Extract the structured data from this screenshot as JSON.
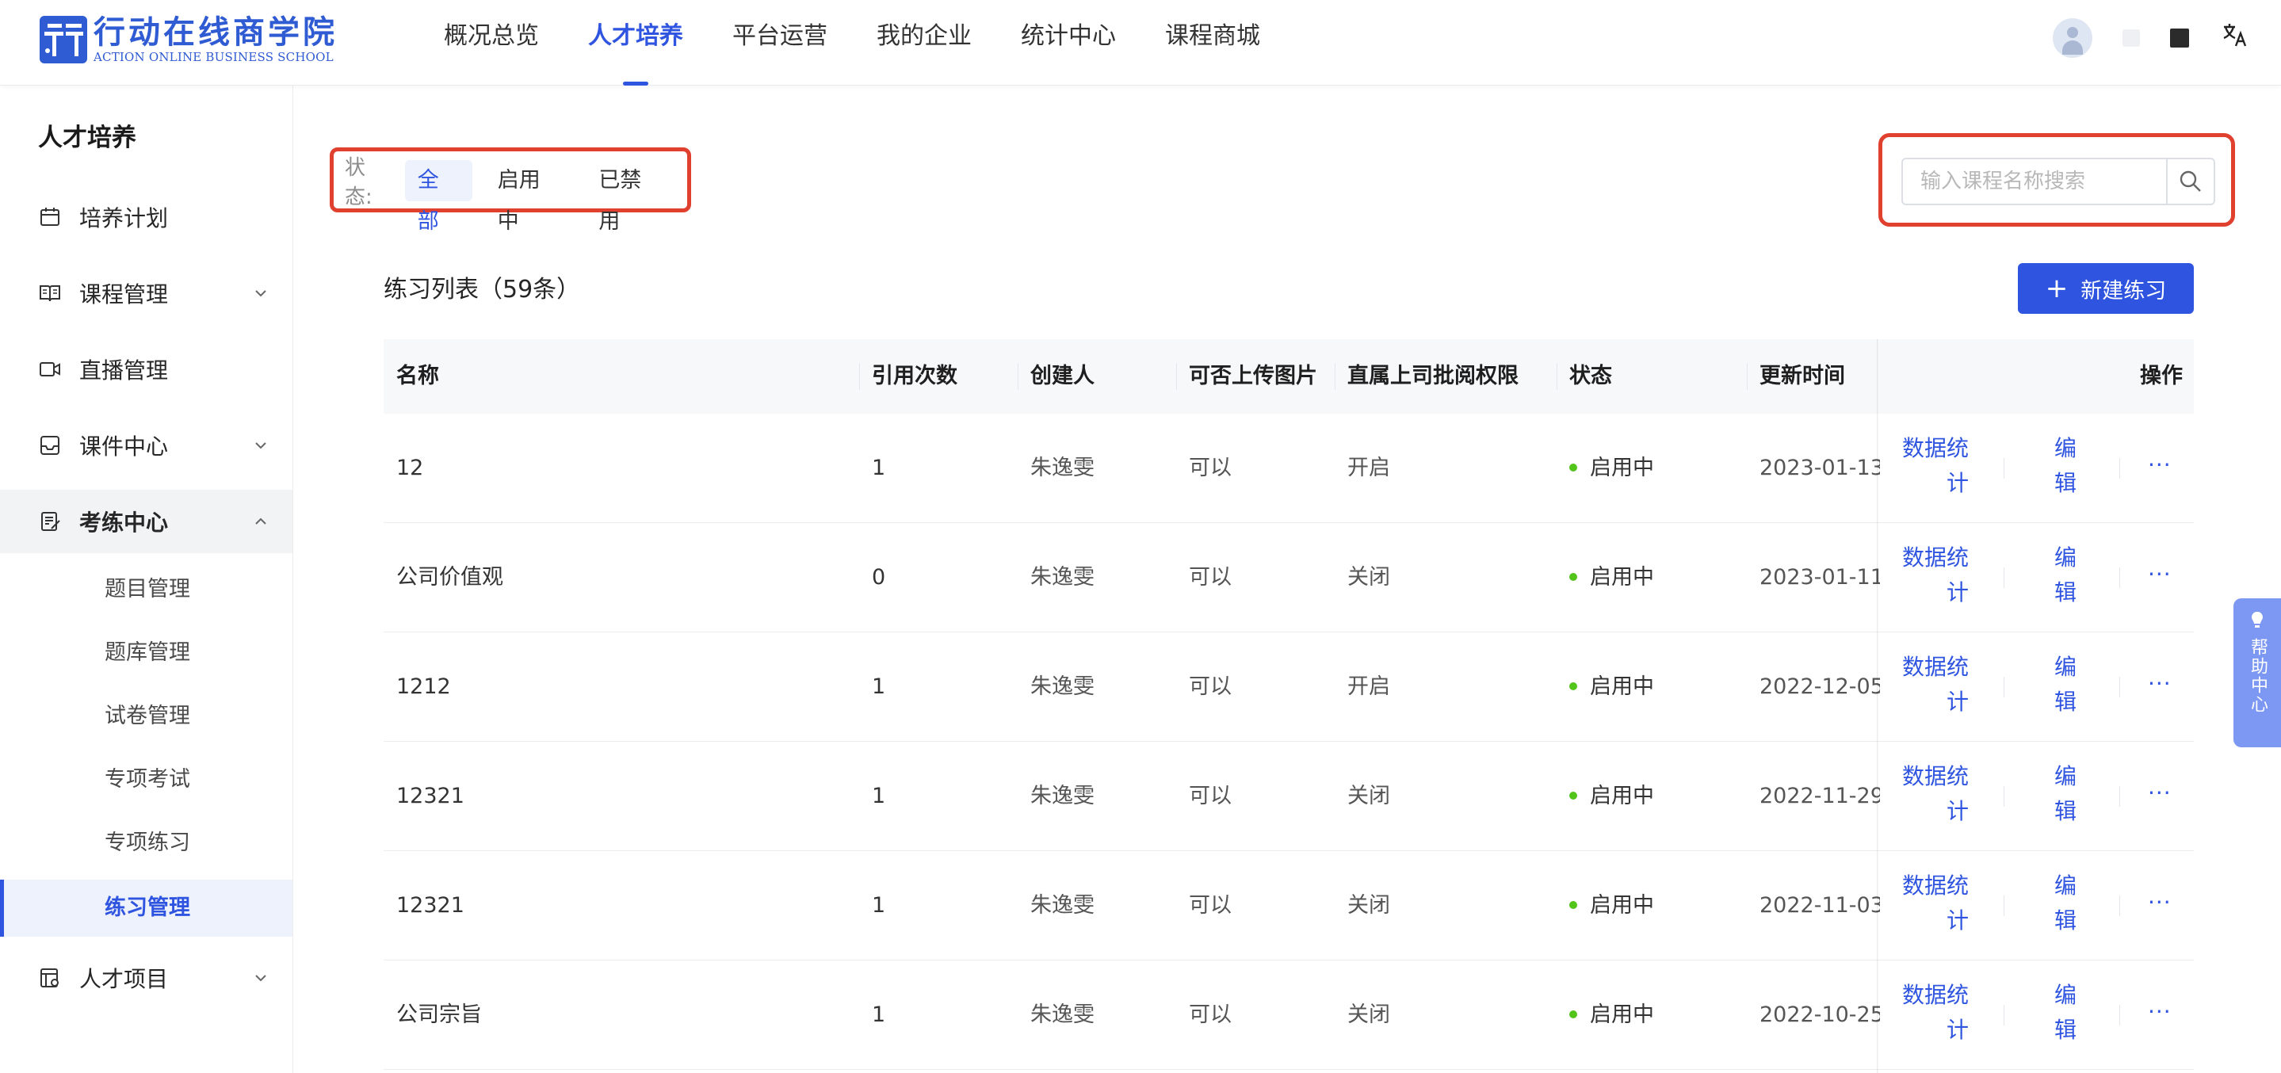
{
  "brand": {
    "name_cn": "行动在线商学院",
    "name_en": "ACTION ONLINE BUSINESS SCHOOL"
  },
  "nav": {
    "items": [
      "概况总览",
      "人才培养",
      "平台运营",
      "我的企业",
      "统计中心",
      "课程商城"
    ],
    "active": "人才培养"
  },
  "top_right": {
    "translate_glyph": "文A"
  },
  "sidebar": {
    "title": "人才培养",
    "items": [
      {
        "label": "培养计划",
        "icon": "calendar-icon"
      },
      {
        "label": "课程管理",
        "icon": "book-icon"
      },
      {
        "label": "直播管理",
        "icon": "video-icon"
      },
      {
        "label": "课件中心",
        "icon": "inbox-icon"
      },
      {
        "label": "考练中心",
        "icon": "exam-icon"
      },
      {
        "label": "人才项目",
        "icon": "project-icon"
      }
    ],
    "sub_items": [
      "题目管理",
      "题库管理",
      "试卷管理",
      "专项考试",
      "专项练习",
      "练习管理"
    ],
    "active_sub": "练习管理"
  },
  "filter": {
    "label": "状态:",
    "options": [
      "全部",
      "启用中",
      "已禁用"
    ],
    "active": "全部"
  },
  "search": {
    "placeholder": "输入课程名称搜索",
    "value": ""
  },
  "list": {
    "title": "练习列表（59条）",
    "new_button": "新建练习",
    "columns": [
      "名称",
      "引用次数",
      "创建人",
      "可否上传图片",
      "直属上司批阅权限",
      "状态",
      "更新时间",
      "操作"
    ],
    "rows": [
      {
        "name": "12",
        "refs": "1",
        "creator": "朱逸雯",
        "upload": "可以",
        "review": "开启",
        "status": "启用中",
        "updated": "2023-01-13"
      },
      {
        "name": "公司价值观",
        "refs": "0",
        "creator": "朱逸雯",
        "upload": "可以",
        "review": "关闭",
        "status": "启用中",
        "updated": "2023-01-11"
      },
      {
        "name": "1212",
        "refs": "1",
        "creator": "朱逸雯",
        "upload": "可以",
        "review": "开启",
        "status": "启用中",
        "updated": "2022-12-05"
      },
      {
        "name": "12321",
        "refs": "1",
        "creator": "朱逸雯",
        "upload": "可以",
        "review": "关闭",
        "status": "启用中",
        "updated": "2022-11-29"
      },
      {
        "name": "12321",
        "refs": "1",
        "creator": "朱逸雯",
        "upload": "可以",
        "review": "关闭",
        "status": "启用中",
        "updated": "2022-11-03"
      },
      {
        "name": "公司宗旨",
        "refs": "1",
        "creator": "朱逸雯",
        "upload": "可以",
        "review": "关闭",
        "status": "启用中",
        "updated": "2022-10-25"
      }
    ],
    "actions": {
      "stats_line1": "数据统",
      "stats_line2": "计",
      "edit_line1": "编",
      "edit_line2": "辑",
      "more": "···"
    }
  },
  "help": {
    "label": "帮助中心"
  },
  "colors": {
    "primary": "#2f55e0",
    "highlight_border": "#e0412f",
    "status_green": "#52c41a",
    "help_bg": "#7d98f2"
  }
}
